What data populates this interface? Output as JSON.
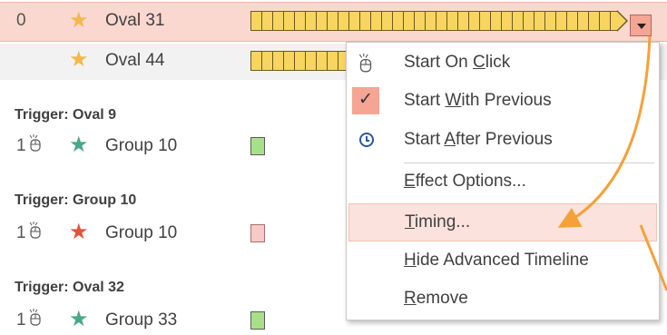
{
  "colors": {
    "selected_row": "#fad7cf",
    "star_gold": "#f2b84b",
    "star_teal": "#4aa883",
    "star_red": "#e0553a",
    "timeline_bar": "#f7d560",
    "swatch_green": "#a8e08a",
    "swatch_pink": "#f7c9c9",
    "accent": "#f4a593",
    "arrow": "#f5a13a"
  },
  "effects": [
    {
      "number": "0",
      "icon": "star-icon",
      "name": "Oval 31",
      "timeline_progress": 0.55,
      "selected": true
    },
    {
      "number": "",
      "icon": "star-icon",
      "name": "Oval 44"
    }
  ],
  "triggers": [
    {
      "label": "Trigger: Oval 9",
      "number": "1",
      "icon": "mouse-click-icon",
      "effect_icon": "star-icon",
      "effect_name": "Group 10"
    },
    {
      "label": "Trigger: Group 10",
      "number": "1",
      "icon": "mouse-click-icon",
      "effect_icon": "star-icon",
      "effect_name": "Group 10"
    },
    {
      "label": "Trigger: Oval 32",
      "number": "1",
      "icon": "mouse-click-icon",
      "effect_icon": "star-icon",
      "effect_name": "Group 33"
    }
  ],
  "context_menu": {
    "items": [
      {
        "pre": "Start On ",
        "ul": "C",
        "post": "lick",
        "icon": "mouse-click-icon"
      },
      {
        "pre": "Start ",
        "ul": "W",
        "post": "ith Previous",
        "icon": "checkmark-icon",
        "checked": true
      },
      {
        "pre": "Start ",
        "ul": "A",
        "post": "fter Previous",
        "icon": "clock-icon"
      },
      {
        "pre": "",
        "ul": "E",
        "post": "ffect Options...",
        "icon": ""
      },
      {
        "pre": "",
        "ul": "T",
        "post": "iming...",
        "icon": "",
        "highlighted": true
      },
      {
        "pre": "",
        "ul": "H",
        "post": "ide Advanced Timeline",
        "icon": ""
      },
      {
        "pre": "",
        "ul": "R",
        "post": "emove",
        "icon": ""
      }
    ]
  }
}
